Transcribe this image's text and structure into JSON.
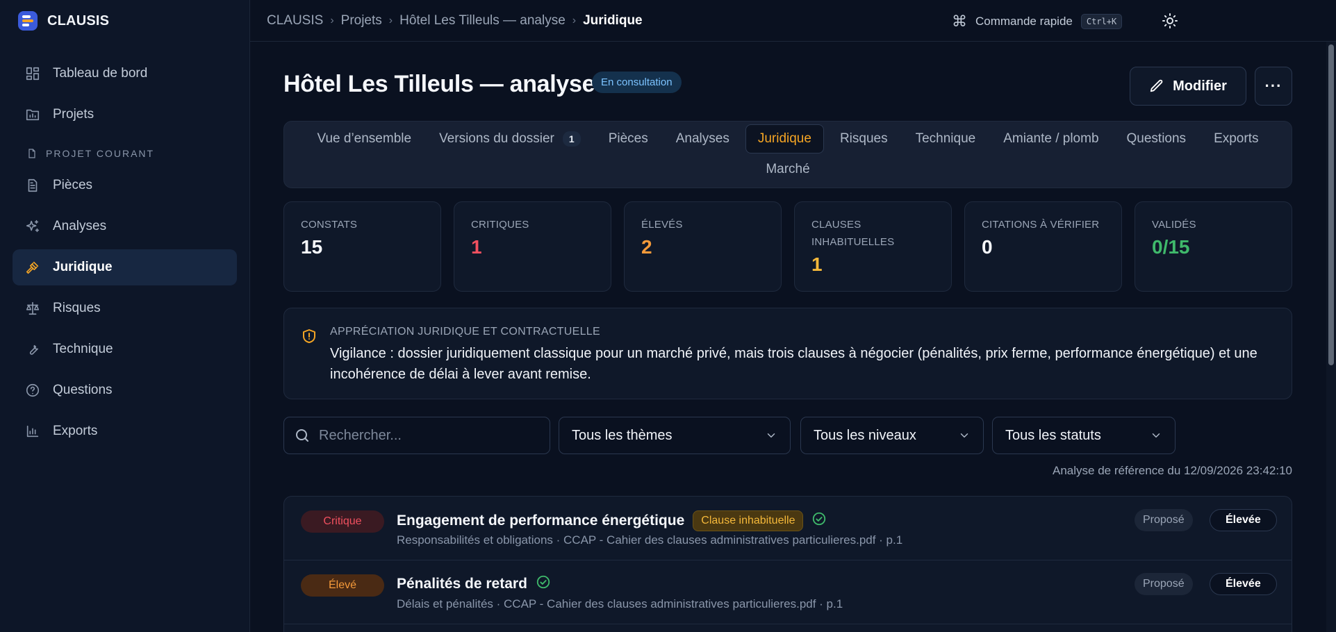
{
  "brand": {
    "name": "CLAUSIS"
  },
  "sidebar": {
    "items": [
      {
        "label": "Tableau de bord",
        "icon": "dashboard-icon"
      },
      {
        "label": "Projets",
        "icon": "projects-icon"
      }
    ],
    "section_label": "PROJET COURANT",
    "project_items": [
      {
        "label": "Pièces",
        "icon": "document-icon"
      },
      {
        "label": "Analyses",
        "icon": "sparkles-icon"
      },
      {
        "label": "Juridique",
        "icon": "gavel-icon",
        "active": true
      },
      {
        "label": "Risques",
        "icon": "scale-icon"
      },
      {
        "label": "Technique",
        "icon": "wrench-icon"
      },
      {
        "label": "Questions",
        "icon": "help-circle-icon"
      },
      {
        "label": "Exports",
        "icon": "bar-chart-icon"
      }
    ]
  },
  "topbar": {
    "breadcrumb": [
      "CLAUSIS",
      "Projets",
      "Hôtel Les Tilleuls — analyse",
      "Juridique"
    ],
    "command_label": "Commande rapide",
    "command_shortcut": "Ctrl+K"
  },
  "header": {
    "title": "Hôtel Les Tilleuls — analyse",
    "status_badge": "En consultation",
    "modify_label": "Modifier",
    "more_label": "···"
  },
  "tabs": [
    {
      "label": "Vue d’ensemble"
    },
    {
      "label": "Versions du dossier",
      "count": "1"
    },
    {
      "label": "Pièces"
    },
    {
      "label": "Analyses"
    },
    {
      "label": "Juridique",
      "active": true
    },
    {
      "label": "Risques"
    },
    {
      "label": "Technique"
    },
    {
      "label": "Amiante / plomb"
    },
    {
      "label": "Questions"
    },
    {
      "label": "Exports"
    },
    {
      "label": "Marché"
    }
  ],
  "stats": [
    {
      "label": "CONSTATS",
      "value": "15",
      "color": "#f5f7fb"
    },
    {
      "label": "CRITIQUES",
      "value": "1",
      "color": "#f0505f"
    },
    {
      "label": "ÉLEVÉS",
      "value": "2",
      "color": "#f59a3a"
    },
    {
      "label": "CLAUSES INHABITUELLES",
      "value": "1",
      "color": "#f5b83a"
    },
    {
      "label": "CITATIONS À VÉRIFIER",
      "value": "0",
      "color": "#f5f7fb"
    },
    {
      "label": "VALIDÉS",
      "value": "0/15",
      "color": "#3fb96b"
    }
  ],
  "appraisal": {
    "label": "APPRÉCIATION JURIDIQUE ET CONTRACTUELLE",
    "text": "Vigilance : dossier juridiquement classique pour un marché privé, mais trois clauses à négocier (pénalités, prix ferme, performance énergétique) et une incohérence de délai à lever avant remise."
  },
  "filters": {
    "search_placeholder": "Rechercher...",
    "themes": "Tous les thèmes",
    "levels": "Tous les niveaux",
    "statuses": "Tous les statuts"
  },
  "reference_date": "Analyse de référence du 12/09/2026 23:42:10",
  "findings": [
    {
      "severity": "Critique",
      "title": "Engagement de performance énergétique",
      "tag": "Clause inhabituelle",
      "subtitle": "Responsabilités et obligations · CCAP - Cahier des clauses administratives particulieres.pdf · p.1",
      "status": "Proposé",
      "level": "Élevée"
    },
    {
      "severity": "Élevé",
      "title": "Pénalités de retard",
      "tag": "",
      "subtitle": "Délais et pénalités · CCAP - Cahier des clauses administratives particulieres.pdf · p.1",
      "status": "Proposé",
      "level": "Élevée"
    }
  ],
  "colors": {
    "accent": "#f5a524",
    "background": "#0a1120",
    "critical": "#f0505f",
    "high": "#f59a3a",
    "validated": "#3fb96b",
    "info": "#7cc3ff"
  }
}
